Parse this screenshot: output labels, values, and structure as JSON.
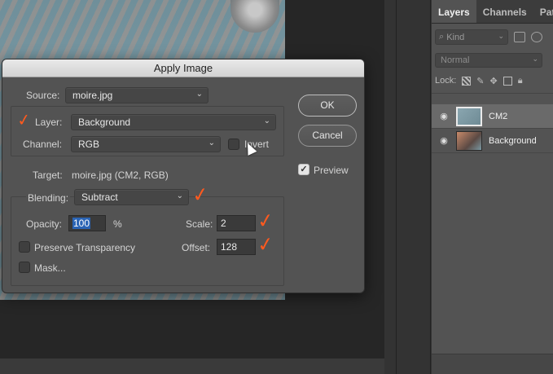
{
  "layers_panel": {
    "tabs": [
      "Layers",
      "Channels",
      "Paths"
    ],
    "kind_placeholder": "Kind",
    "blend_mode": "Normal",
    "lock_label": "Lock:",
    "layers": [
      {
        "name": "CM2",
        "selected": true
      },
      {
        "name": "Background",
        "selected": false
      }
    ]
  },
  "dialog": {
    "title": "Apply Image",
    "source_label": "Source:",
    "source_value": "moire.jpg",
    "layer_label": "Layer:",
    "layer_value": "Background",
    "channel_label": "Channel:",
    "channel_value": "RGB",
    "invert_label": "Invert",
    "invert_checked": false,
    "target_label": "Target:",
    "target_value": "moire.jpg (CM2, RGB)",
    "blending_label": "Blending:",
    "blending_value": "Subtract",
    "opacity_label": "Opacity:",
    "opacity_value": "100",
    "opacity_unit": "%",
    "scale_label": "Scale:",
    "scale_value": "2",
    "offset_label": "Offset:",
    "offset_value": "128",
    "preserve_transparency_label": "Preserve Transparency",
    "preserve_transparency_checked": false,
    "mask_label": "Mask...",
    "mask_checked": false,
    "ok_label": "OK",
    "cancel_label": "Cancel",
    "preview_label": "Preview",
    "preview_checked": true
  },
  "colors": {
    "annotation": "#ff5a1f",
    "dialog_bg": "#535353",
    "highlight": "#2a64b5"
  }
}
